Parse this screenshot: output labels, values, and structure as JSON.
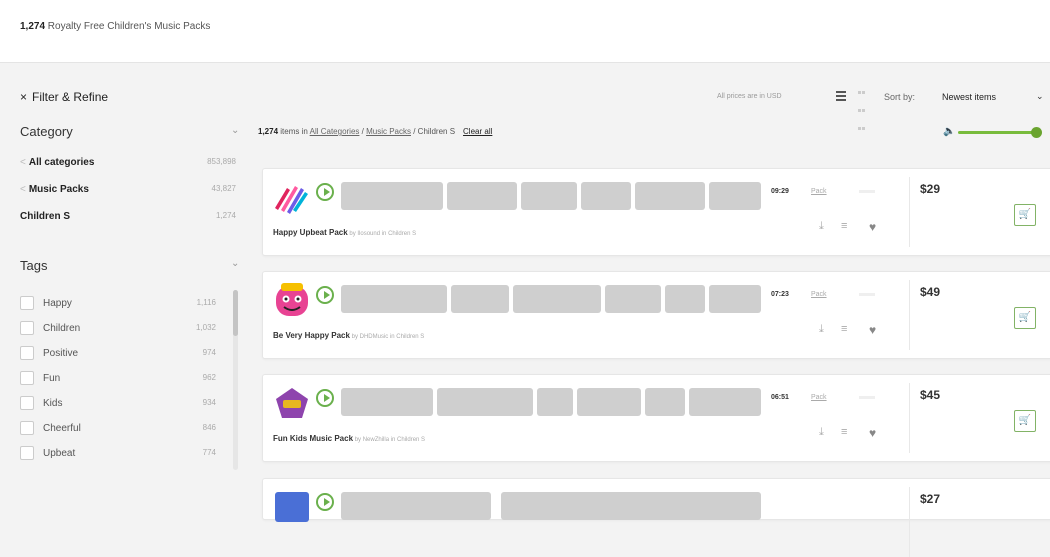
{
  "header": {
    "count": "1,274",
    "title_rest": " Royalty Free Children's Music Packs"
  },
  "filter": {
    "close": "×",
    "title": "Filter & Refine"
  },
  "category": {
    "heading": "Category",
    "items": [
      {
        "label": "All categories",
        "count": "853,898",
        "back": true
      },
      {
        "label": "Music Packs",
        "count": "43,827",
        "back": true
      },
      {
        "label": "Children S",
        "count": "1,274",
        "back": false
      }
    ]
  },
  "tags": {
    "heading": "Tags",
    "items": [
      {
        "label": "Happy",
        "count": "1,116"
      },
      {
        "label": "Children",
        "count": "1,032"
      },
      {
        "label": "Positive",
        "count": "974"
      },
      {
        "label": "Fun",
        "count": "962"
      },
      {
        "label": "Kids",
        "count": "934"
      },
      {
        "label": "Cheerful",
        "count": "846"
      },
      {
        "label": "Upbeat",
        "count": "774"
      }
    ]
  },
  "toolbar": {
    "prices_note": "All prices are in USD",
    "sort_label": "Sort by:",
    "sort_value": "Newest items"
  },
  "breadcrumb": {
    "count": "1,274",
    "items_in": " items in ",
    "cat1": "All Categories",
    "sep": " / ",
    "cat2": "Music Packs",
    "cat3": "Children S",
    "clear": "Clear all"
  },
  "volume_level": 0.95,
  "products": [
    {
      "title": "Happy Upbeat Pack",
      "meta": " by Ilosound in Children S",
      "duration": "09:29",
      "type": "Pack",
      "price": "$29"
    },
    {
      "title": "Be Very Happy Pack",
      "meta": " by DHDMusic in Children S",
      "duration": "07:23",
      "type": "Pack",
      "price": "$49"
    },
    {
      "title": "Fun Kids Music Pack",
      "meta": " by NewZhilla in Children S",
      "duration": "06:51",
      "type": "Pack",
      "price": "$45"
    },
    {
      "price": "$27"
    }
  ],
  "icons": {
    "download": "download-icon",
    "add_to_list": "add-to-list-icon",
    "favorite": "heart-icon",
    "cart": "add-to-cart-icon"
  },
  "colors": {
    "accent": "#6ab04c"
  }
}
